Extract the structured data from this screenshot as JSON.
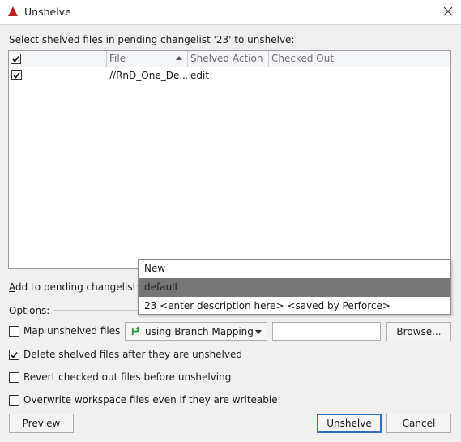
{
  "window": {
    "title": "Unshelve",
    "icon": "perforce-warning-icon",
    "accent": "#c0201e"
  },
  "prompt": "Select shelved files in pending changelist '23' to unshelve:",
  "table": {
    "columns": [
      "",
      "File",
      "Shelved Action",
      "Checked Out"
    ],
    "header_checked": true,
    "rows": [
      {
        "checked": true,
        "file": "//RnD_One_De...",
        "action": "edit",
        "checked_out": ""
      }
    ]
  },
  "changelist": {
    "label": "Add to pending changelist:",
    "options": [
      "New",
      "default",
      "23  <enter description here> <saved by Perforce>"
    ],
    "selected": "default"
  },
  "options": {
    "legend": "Options:",
    "map": {
      "label": "Map unshelved files",
      "checked": false,
      "mapping_value": "using Branch Mapping",
      "text_value": ""
    },
    "browse_label": "Browse...",
    "delete": {
      "label": "Delete shelved files after they are unshelved",
      "checked": true
    },
    "revert": {
      "label": "Revert checked out files before unshelving",
      "checked": false
    },
    "overwrite": {
      "label": "Overwrite workspace files even if they are writeable",
      "checked": false
    }
  },
  "buttons": {
    "preview": "Preview",
    "unshelve": "Unshelve",
    "cancel": "Cancel"
  },
  "colors": {
    "dialog_bg": "#f0f0f0",
    "selection": "#767676",
    "default_button_border": "#2f6fbd",
    "branch_icon": "#2e9b3c"
  }
}
